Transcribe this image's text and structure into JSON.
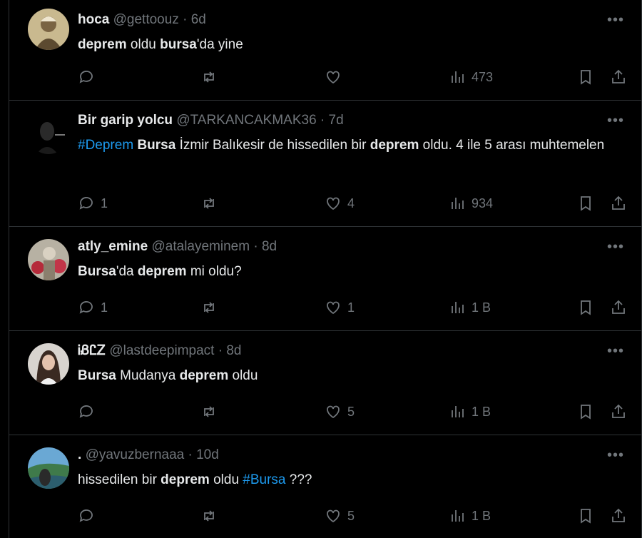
{
  "tweets": [
    {
      "name": "hoca",
      "handle": "@gettoouz",
      "time": "6d",
      "parts": [
        {
          "t": "deprem",
          "s": "bold"
        },
        {
          "t": " oldu ",
          "s": "plain"
        },
        {
          "t": "bursa",
          "s": "bold"
        },
        {
          "t": "'da yine",
          "s": "plain"
        }
      ],
      "replies": "",
      "likes": "",
      "views": "473"
    },
    {
      "name": "Bir garip yolcu",
      "handle": "@TARKANCAKMAK36",
      "time": "7d",
      "parts": [
        {
          "t": "#Deprem",
          "s": "hashtag"
        },
        {
          "t": " ",
          "s": "plain"
        },
        {
          "t": "Bursa",
          "s": "bold"
        },
        {
          "t": " İzmir Balıkesir de hissedilen bir ",
          "s": "plain"
        },
        {
          "t": "deprem",
          "s": "bold"
        },
        {
          "t": " oldu. 4 ile 5 arası muhtemelen",
          "s": "plain"
        }
      ],
      "replies": "1",
      "likes": "4",
      "views": "934"
    },
    {
      "name": "atly_emine",
      "handle": "@atalayeminem",
      "time": "8d",
      "parts": [
        {
          "t": "Bursa",
          "s": "bold"
        },
        {
          "t": "'da ",
          "s": "plain"
        },
        {
          "t": "deprem",
          "s": "bold"
        },
        {
          "t": " mi oldu?",
          "s": "plain"
        }
      ],
      "replies": "1",
      "likes": "1",
      "views": "1 B"
    },
    {
      "name": "ᎥᏰᏝᏃ",
      "handle": "@lastdeepimpact",
      "time": "8d",
      "parts": [
        {
          "t": "Bursa",
          "s": "bold"
        },
        {
          "t": " Mudanya ",
          "s": "plain"
        },
        {
          "t": "deprem",
          "s": "bold"
        },
        {
          "t": " oldu",
          "s": "plain"
        }
      ],
      "replies": "",
      "likes": "5",
      "views": "1 B"
    },
    {
      "name": ".",
      "handle": "@yavuzbernaaa",
      "time": "10d",
      "parts": [
        {
          "t": "hissedilen bir ",
          "s": "plain"
        },
        {
          "t": "deprem",
          "s": "bold"
        },
        {
          "t": " oldu ",
          "s": "plain"
        },
        {
          "t": "#Bursa",
          "s": "hashtag"
        },
        {
          "t": " ???",
          "s": "plain"
        }
      ],
      "replies": "",
      "likes": "5",
      "views": "1 B"
    }
  ],
  "icons": {
    "reply": "reply-icon",
    "retweet": "retweet-icon",
    "like": "heart-icon",
    "views": "views-icon",
    "bookmark": "bookmark-icon",
    "share": "share-icon",
    "more": "more-icon"
  },
  "colors": {
    "background": "#000000",
    "text": "#e7e9ea",
    "muted": "#71767b",
    "hashtag": "#1d9bf0",
    "divider": "#2f3336"
  }
}
